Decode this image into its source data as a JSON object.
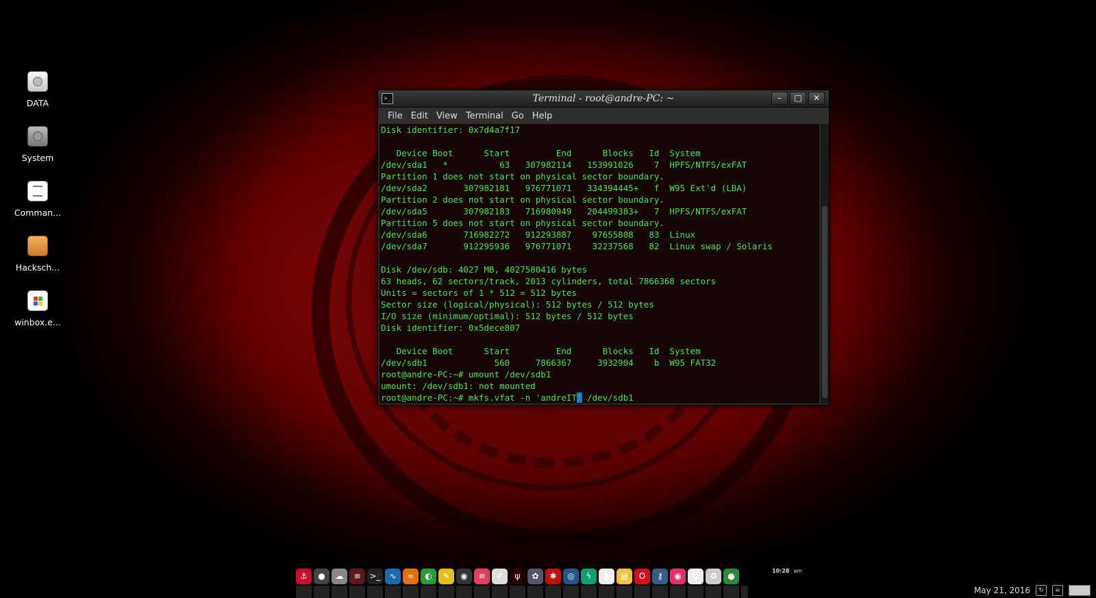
{
  "desktop": {
    "icons": [
      {
        "label": "DATA",
        "icon": "drive-icon"
      },
      {
        "label": "System",
        "icon": "system-drive-icon"
      },
      {
        "label": "Comman...",
        "icon": "text-document-icon"
      },
      {
        "label": "Hacksch...",
        "icon": "package-icon"
      },
      {
        "label": "winbox.e...",
        "icon": "executable-icon"
      }
    ]
  },
  "terminal": {
    "title": "Terminal - root@andre-PC: ~",
    "menu": [
      "File",
      "Edit",
      "View",
      "Terminal",
      "Go",
      "Help"
    ],
    "lines": [
      "Disk identifier: 0x7d4a7f17",
      "",
      "   Device Boot      Start         End      Blocks   Id  System",
      "/dev/sda1   *          63   307982114   153991026    7  HPFS/NTFS/exFAT",
      "Partition 1 does not start on physical sector boundary.",
      "/dev/sda2       307982181   976771071   334394445+   f  W95 Ext'd (LBA)",
      "Partition 2 does not start on physical sector boundary.",
      "/dev/sda5       307982183   716980949   204499383+   7  HPFS/NTFS/exFAT",
      "Partition 5 does not start on physical sector boundary.",
      "/dev/sda6       716982272   912293887    97655808   83  Linux",
      "/dev/sda7       912295936   976771071    32237568   82  Linux swap / Solaris",
      "",
      "Disk /dev/sdb: 4027 MB, 4027580416 bytes",
      "63 heads, 62 sectors/track, 2013 cylinders, total 7866368 sectors",
      "Units = sectors of 1 * 512 = 512 bytes",
      "Sector size (logical/physical): 512 bytes / 512 bytes",
      "I/O size (minimum/optimal): 512 bytes / 512 bytes",
      "Disk identifier: 0x5dece807",
      "",
      "   Device Boot      Start         End      Blocks   Id  System",
      "/dev/sdb1             560     7866367     3932904    b  W95 FAT32",
      "root@andre-PC:~# umount /dev/sdb1",
      "umount: /dev/sdb1: not mounted"
    ],
    "prompt_before": "root@andre-PC:~# mkfs.vfat -n 'andreIT",
    "prompt_cursor": "'",
    "prompt_after": " /dev/sdb1"
  },
  "dock": {
    "icons": [
      {
        "name": "anchor-icon",
        "color": "#c8102e",
        "glyph": "⚓"
      },
      {
        "name": "globe-icon",
        "color": "#444444",
        "glyph": "●"
      },
      {
        "name": "cloud-icon",
        "color": "#888888",
        "glyph": "☁"
      },
      {
        "name": "task-manager-icon",
        "color": "#5a1a1a",
        "glyph": "≡"
      },
      {
        "name": "terminal-icon",
        "color": "#222222",
        "glyph": ">_"
      },
      {
        "name": "system-monitor-icon",
        "color": "#1a6ab0",
        "glyph": "∿"
      },
      {
        "name": "signal-icon",
        "color": "#e07010",
        "glyph": "≈"
      },
      {
        "name": "toggle-icon",
        "color": "#2a9a3a",
        "glyph": "◐"
      },
      {
        "name": "notes-icon",
        "color": "#e0c020",
        "glyph": "✎"
      },
      {
        "name": "camera-icon",
        "color": "#333333",
        "glyph": "◉"
      },
      {
        "name": "rainbow-icon",
        "color": "#e04060",
        "glyph": "≡"
      },
      {
        "name": "editor-icon",
        "color": "#dddddd",
        "glyph": "✐"
      },
      {
        "name": "radio-icon",
        "color": "#2a0000",
        "glyph": "ψ"
      },
      {
        "name": "media-player-icon",
        "color": "#555566",
        "glyph": "✿"
      },
      {
        "name": "ladybug-icon",
        "color": "#c01010",
        "glyph": "✱"
      },
      {
        "name": "eye-icon",
        "color": "#225588",
        "glyph": "◎"
      },
      {
        "name": "lightning-icon",
        "color": "#10a070",
        "glyph": "ϟ"
      },
      {
        "name": "usb-icon",
        "color": "#eeeeee",
        "glyph": "▮"
      },
      {
        "name": "sticky-note-icon",
        "color": "#f0c040",
        "glyph": "▤"
      },
      {
        "name": "opera-icon",
        "color": "#d01020",
        "glyph": "O"
      },
      {
        "name": "keyhole-icon",
        "color": "#3a5a8a",
        "glyph": "⚷"
      },
      {
        "name": "webcam-icon",
        "color": "#e03070",
        "glyph": "◉"
      },
      {
        "name": "mask-icon",
        "color": "#eeeeee",
        "glyph": "☺"
      },
      {
        "name": "recycle-icon",
        "color": "#cccccc",
        "glyph": "♻"
      },
      {
        "name": "power-icon",
        "color": "#2a8a3a",
        "glyph": "●"
      }
    ],
    "clock": "10:28",
    "clock_suffix": "am"
  },
  "tray": {
    "date": "May 21, 2016"
  }
}
